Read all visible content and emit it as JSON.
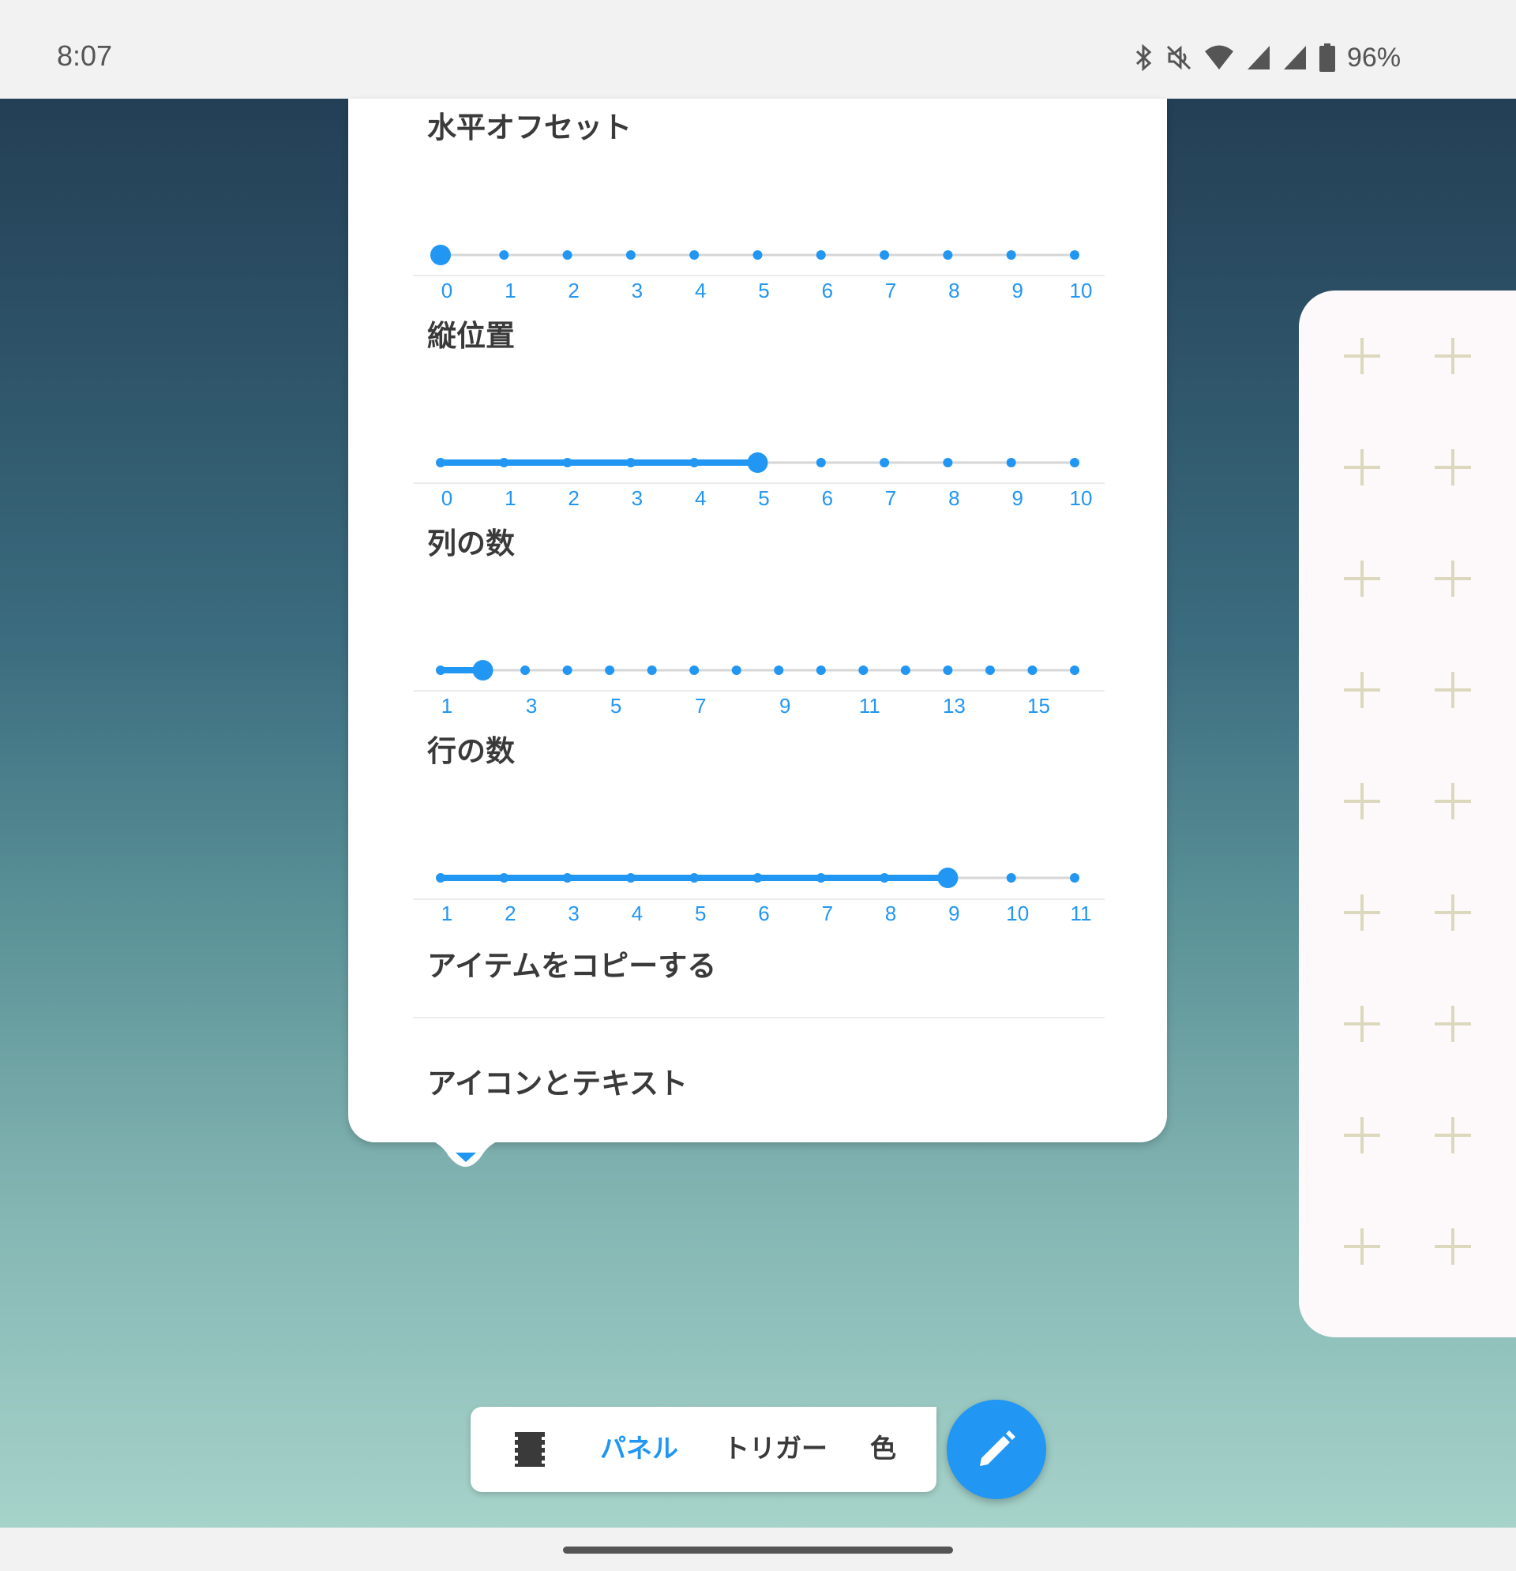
{
  "status_bar": {
    "time": "8:07",
    "icons": [
      "bluetooth-icon",
      "mute-icon",
      "wifi-icon",
      "signal-icon",
      "signal-icon",
      "battery-icon"
    ],
    "battery": "96%"
  },
  "popup": {
    "settings": [
      {
        "title": "水平オフセット",
        "ticks": [
          0,
          1,
          2,
          3,
          4,
          5,
          6,
          7,
          8,
          9,
          10
        ],
        "labels": [
          "0",
          "1",
          "2",
          "3",
          "4",
          "5",
          "6",
          "7",
          "8",
          "9",
          "10"
        ],
        "value": 0
      },
      {
        "title": "縦位置",
        "ticks": [
          0,
          1,
          2,
          3,
          4,
          5,
          6,
          7,
          8,
          9,
          10
        ],
        "labels": [
          "0",
          "1",
          "2",
          "3",
          "4",
          "5",
          "6",
          "7",
          "8",
          "9",
          "10"
        ],
        "value": 5
      },
      {
        "title": "列の数",
        "ticks": [
          1,
          2,
          3,
          4,
          5,
          6,
          7,
          8,
          9,
          10,
          11,
          12,
          13,
          14,
          15,
          16
        ],
        "labels": [
          "1",
          "3",
          "5",
          "7",
          "9",
          "11",
          "13",
          "15"
        ],
        "value": 2
      },
      {
        "title": "行の数",
        "ticks": [
          1,
          2,
          3,
          4,
          5,
          6,
          7,
          8,
          9,
          10,
          11
        ],
        "labels": [
          "1",
          "2",
          "3",
          "4",
          "5",
          "6",
          "7",
          "8",
          "9",
          "10",
          "11"
        ],
        "value": 9
      }
    ],
    "menu_items": [
      "アイテムをコピーする",
      "アイコンとテキスト"
    ]
  },
  "toolbar": {
    "film_icon": "film-icon",
    "tabs": [
      "パネル",
      "トリガー",
      "色"
    ],
    "active_tab": "パネル",
    "fab_icon": "pencil-icon"
  },
  "colors": {
    "accent": "#2196f3",
    "track": "#d6d6d6",
    "plus": "#dcd8bd",
    "panel": "#fdf9fb"
  }
}
